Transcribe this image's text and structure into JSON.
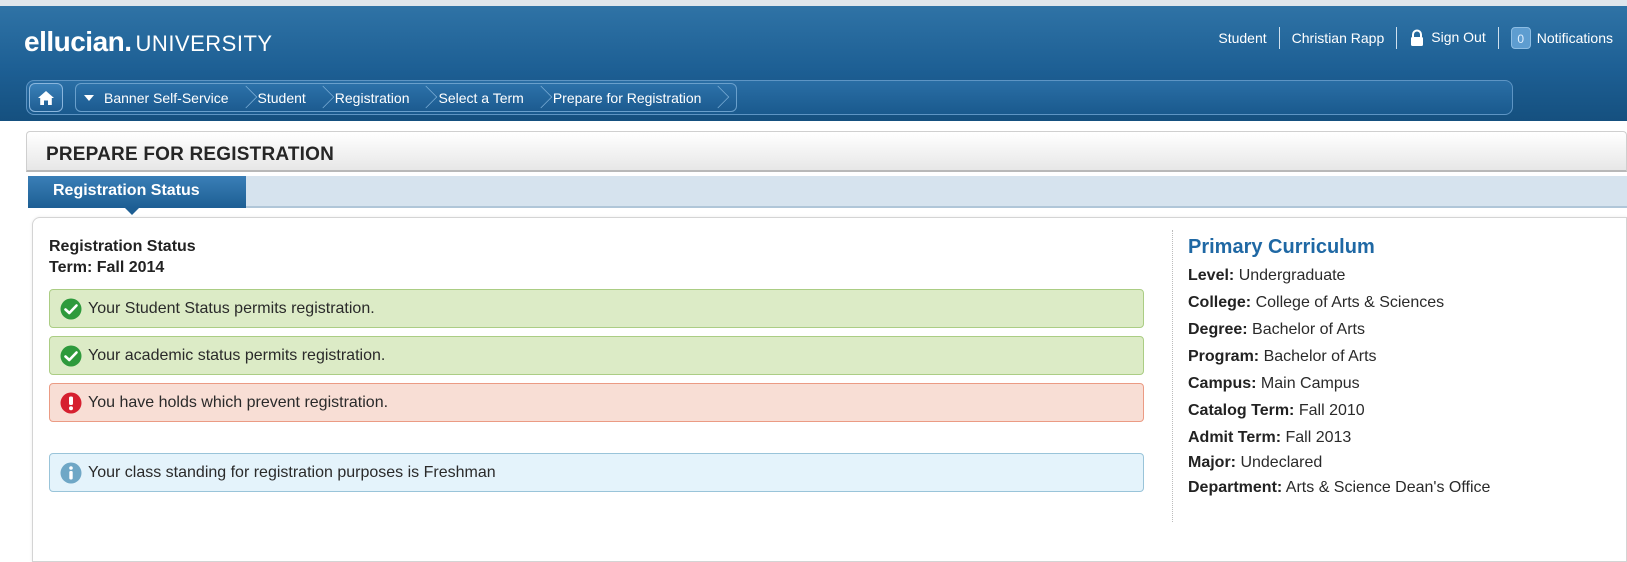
{
  "header": {
    "brand_main": "ellucian.",
    "brand_sub": "UNIVERSITY",
    "nav": {
      "student": "Student",
      "user_name": "Christian Rapp",
      "sign_out": "Sign Out",
      "notification_count": "0",
      "notifications": "Notifications"
    },
    "breadcrumbs": [
      "Banner Self-Service",
      "Student",
      "Registration",
      "Select a Term",
      "Prepare for Registration"
    ]
  },
  "page": {
    "title": "PREPARE FOR REGISTRATION",
    "tab": "Registration Status"
  },
  "status": {
    "heading": "Registration Status",
    "term": "Term: Fall 2014",
    "messages": [
      {
        "type": "ok",
        "text": "Your Student Status permits registration."
      },
      {
        "type": "ok",
        "text": "Your academic status permits registration."
      },
      {
        "type": "error",
        "text": "You have holds which prevent registration."
      },
      {
        "type": "info",
        "text": "Your class standing for registration purposes is Freshman"
      }
    ]
  },
  "curriculum": {
    "title": "Primary Curriculum",
    "rows": [
      {
        "label": "Level:",
        "value": "Undergraduate"
      },
      {
        "label": "College:",
        "value": "College of Arts & Sciences"
      },
      {
        "label": "Degree:",
        "value": "Bachelor of Arts"
      },
      {
        "label": "Program:",
        "value": "Bachelor of Arts"
      },
      {
        "label": "Campus:",
        "value": "Main Campus"
      },
      {
        "label": "Catalog Term:",
        "value": "Fall 2010"
      },
      {
        "label": "Admit Term:",
        "value": "Fall 2013"
      },
      {
        "label": "Major:",
        "value": "Undeclared"
      },
      {
        "label": "Department:",
        "value": "Arts & Science Dean's Office"
      }
    ]
  },
  "colors": {
    "header_blue": "#1d5f94",
    "curriculum_title": "#1f68a4",
    "ok_icon": "#2e9a3c",
    "error_icon": "#d62030",
    "info_icon": "#6fa7c6"
  },
  "icons": {
    "home": "home-icon",
    "lock": "lock-icon",
    "ok": "check-circle-icon",
    "error": "exclamation-circle-icon",
    "info": "info-circle-icon"
  }
}
